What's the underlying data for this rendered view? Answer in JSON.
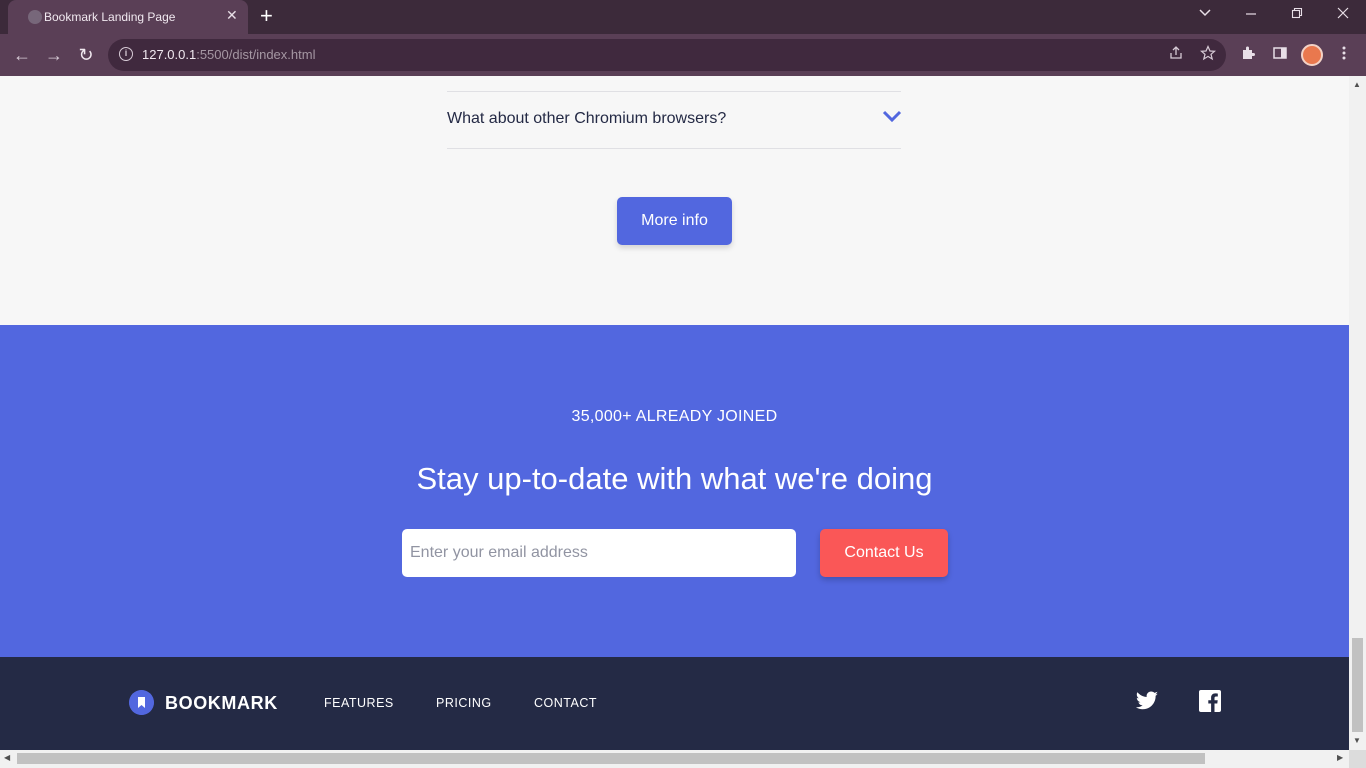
{
  "browser": {
    "tab_title": "Bookmark Landing Page",
    "tab_close": "✕",
    "new_tab": "+",
    "url_host": "127.0.0.1",
    "url_path": ":5500/dist/index.html",
    "back": "←",
    "forward": "→",
    "reload": "↻"
  },
  "faq": {
    "question": "What about other Chromium browsers?",
    "more_button": "More info"
  },
  "newsletter": {
    "joined": "35,000+ ALREADY JOINED",
    "headline": "Stay up-to-date with what we're doing",
    "email_placeholder": "Enter your email address",
    "email_value": "",
    "contact_button": "Contact Us"
  },
  "footer": {
    "logo": "BOOKMARK",
    "links": [
      "FEATURES",
      "PRICING",
      "CONTACT"
    ]
  },
  "colors": {
    "primary": "#5267df",
    "secondary": "#fa5757",
    "dark": "#242a45",
    "page_bg": "#f7f7f7"
  }
}
